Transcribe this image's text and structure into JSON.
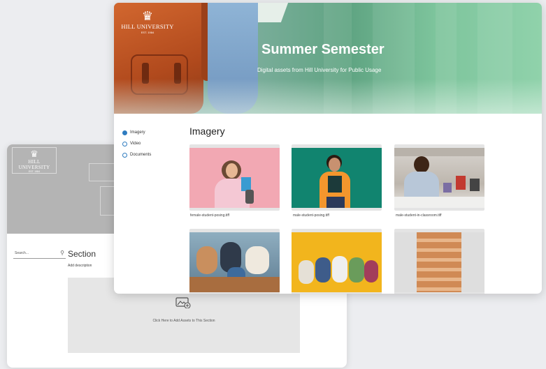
{
  "brand": {
    "university_name": "HILL UNIVERSITY",
    "established": "EST. 1984"
  },
  "hero": {
    "title": "Summer Semester",
    "subtitle": "Digital assets from Hill University for Public Usage"
  },
  "nav": {
    "items": [
      {
        "label": "Imagery",
        "selected": true
      },
      {
        "label": "Video",
        "selected": false
      },
      {
        "label": "Documents",
        "selected": false
      }
    ]
  },
  "gallery": {
    "title": "Imagery",
    "assets": [
      {
        "filename": "female-student-posing.tiff"
      },
      {
        "filename": "male-student-posing.tiff"
      },
      {
        "filename": "male-student-in-classroom.tiff"
      },
      {
        "filename": ""
      },
      {
        "filename": ""
      },
      {
        "filename": ""
      }
    ]
  },
  "editor": {
    "search_placeholder": "Search...",
    "section_title": "Section",
    "section_description": "Add description",
    "add_assets_label": "Click Here to Add Assets to This Section"
  },
  "colors": {
    "accent": "#2f7cc0",
    "hero_green": "#5fa482",
    "backpack_orange": "#c45a26"
  }
}
